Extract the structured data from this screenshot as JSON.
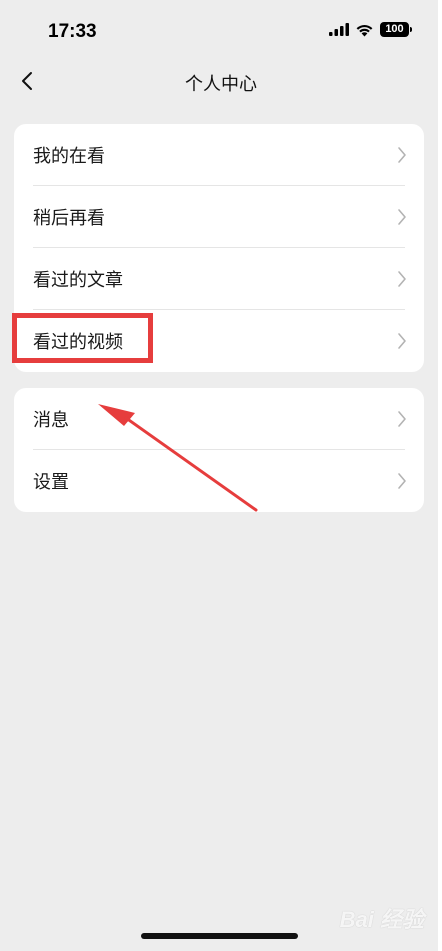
{
  "status_bar": {
    "time": "17:33",
    "battery": "100"
  },
  "nav": {
    "title": "个人中心",
    "back_icon": "chevron-left-icon"
  },
  "groups": [
    {
      "items": [
        {
          "label": "我的在看"
        },
        {
          "label": "稍后再看"
        },
        {
          "label": "看过的文章"
        },
        {
          "label": "看过的视频"
        }
      ]
    },
    {
      "items": [
        {
          "label": "消息"
        },
        {
          "label": "设置"
        }
      ]
    }
  ],
  "annotation": {
    "highlight_color": "#e63d3d",
    "highlighted_item": "看过的视频"
  },
  "watermark": "Bai  经验"
}
